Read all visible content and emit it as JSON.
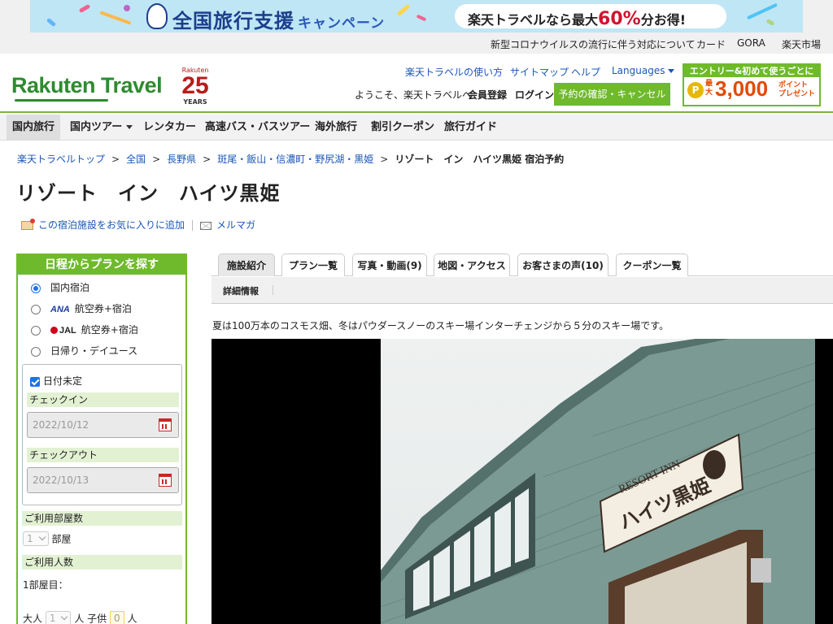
{
  "banner": {
    "title": "全国旅行支援",
    "title_suffix": "キャンペーン",
    "pill_prefix": "楽天トラベルなら最大",
    "pill_big": "60%",
    "pill_suffix": "分お得!",
    "colors": {
      "bg": "#bfe6f5",
      "title": "#1d3e8c",
      "accent": "#d2122e"
    }
  },
  "util_links": [
    "新型コロナウイルスの流行に伴う対応について",
    "カード",
    "GORA",
    "楽天市場"
  ],
  "header": {
    "logo": "Rakuten Travel",
    "anniversary": {
      "brand": "Rakuten",
      "number": "25",
      "years": "YEARS"
    },
    "links": [
      "楽天トラベルの使い方",
      "サイトマップ",
      "ヘルプ",
      "Languages"
    ],
    "welcome": "ようこそ、楽天トラベルへ",
    "register": "会員登録",
    "login": "ログイン",
    "confirm_button": "予約の確認・キャンセル",
    "promo": {
      "top": "エントリー&初めて使うごとに",
      "coin": "P",
      "max": "最大",
      "amount": "3,000",
      "points": "ポイント",
      "present": "プレゼント"
    }
  },
  "gnav": [
    "国内旅行",
    "国内ツアー",
    "レンタカー",
    "高速バス・バスツアー",
    "海外旅行",
    "割引クーポン",
    "旅行ガイド"
  ],
  "breadcrumb": {
    "items": [
      "楽天トラベルトップ",
      "全国",
      "長野県",
      "斑尾・飯山・信濃町・野尻湖・黒姫"
    ],
    "current": "リゾート　イン　ハイツ黒姫 宿泊予約",
    "sep": ">"
  },
  "hotel": {
    "name": "リゾート　イン　ハイツ黒姫",
    "favorite": "この宿泊施設をお気に入りに追加",
    "mail": "メルマガ",
    "description": "夏は100万本のコスモス畑、冬はパウダースノーのスキー場インターチェンジから５分のスキー場です。",
    "sign_en": "RESORT INN",
    "sign_jp": "ハイツ黒姫"
  },
  "search": {
    "heading": "日程からプランを探す",
    "options": [
      {
        "label": "国内宿泊",
        "logo": "",
        "selected": true
      },
      {
        "label": "航空券+宿泊",
        "logo": "ANA",
        "selected": false
      },
      {
        "label": "航空券+宿泊",
        "logo": "JAL",
        "selected": false
      },
      {
        "label": "日帰り・デイユース",
        "logo": "",
        "selected": false
      }
    ],
    "undecided": "日付未定",
    "checkin_label": "チェックイン",
    "checkin_value": "2022/10/12",
    "checkout_label": "チェックアウト",
    "checkout_value": "2022/10/13",
    "rooms_label": "ご利用部屋数",
    "rooms_value": "1",
    "rooms_unit": "部屋",
    "people_label": "ご利用人数",
    "room1": "1部屋目：",
    "adult_label": "大人",
    "adult_value": "1",
    "adult_unit": "人",
    "child_label": "子供",
    "child_value": "0",
    "child_unit": "人"
  },
  "tabs": [
    "施設紹介",
    "プラン一覧",
    "写真・動画(9)",
    "地図・アクセス",
    "お客さまの声(10)",
    "クーポン一覧"
  ],
  "active_tab": "施設紹介",
  "subnav": {
    "item": "詳細情報",
    "sep": "|"
  }
}
